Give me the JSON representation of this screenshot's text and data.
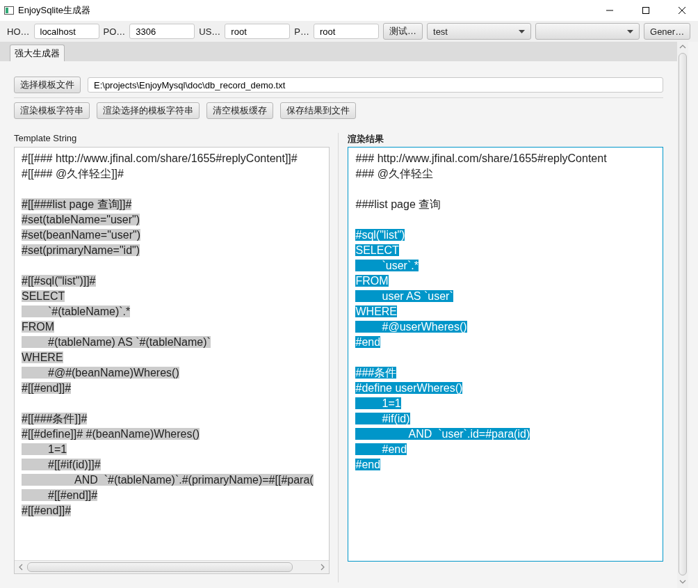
{
  "window": {
    "title": "EnjoySqlite生成器"
  },
  "connection": {
    "fields": [
      {
        "label": "HO…",
        "value": "localhost"
      },
      {
        "label": "PO…",
        "value": "3306"
      },
      {
        "label": "US…",
        "value": "root"
      },
      {
        "label": "P…",
        "value": "root"
      }
    ],
    "test_button": "测试…",
    "database_select": {
      "value": "test"
    },
    "generate_button": "Gener…"
  },
  "tabs": [
    {
      "label": "强大生成器",
      "selected": true
    }
  ],
  "file_row": {
    "button": "选择模板文件",
    "path": "E:\\projects\\EnjoyMysql\\doc\\db_record_demo.txt"
  },
  "actions": [
    "渲染模板字符串",
    "渲染选择的模板字符串",
    "清空模板缓存",
    "保存结果到文件"
  ],
  "template": {
    "title": "Template String",
    "lines": [
      {
        "kind": "code",
        "text": "#[[### http://www.jfinal.com/share/1655#replyContent]]#",
        "selected": false
      },
      {
        "kind": "code",
        "text": "#[[### @久伴轻尘]]#",
        "selected": false
      },
      {
        "kind": "blank"
      },
      {
        "kind": "code",
        "text": "#[[###list page 查询]]#",
        "selected": true
      },
      {
        "kind": "code",
        "text": "#set(tableName=\"user\")",
        "selected": true
      },
      {
        "kind": "code",
        "text": "#set(beanName=\"user\")",
        "selected": true
      },
      {
        "kind": "code",
        "text": "#set(primaryName=\"id\")",
        "selected": true
      },
      {
        "kind": "blank"
      },
      {
        "kind": "code",
        "text": "#[[#sql(\"list\")]]#",
        "selected": true
      },
      {
        "kind": "code",
        "text": "SELECT",
        "selected": true
      },
      {
        "kind": "code",
        "text": "\t`#(tableName)`.*",
        "selected": true
      },
      {
        "kind": "code",
        "text": "FROM",
        "selected": true
      },
      {
        "kind": "code",
        "text": "\t#(tableName) AS `#(tableName)`",
        "selected": true
      },
      {
        "kind": "code",
        "text": "WHERE",
        "selected": true
      },
      {
        "kind": "code",
        "text": "\t#@#(beanName)Wheres()",
        "selected": true
      },
      {
        "kind": "code",
        "text": "#[[#end]]#",
        "selected": true
      },
      {
        "kind": "blank"
      },
      {
        "kind": "code",
        "text": "#[[###条件]]#",
        "selected": true
      },
      {
        "kind": "code",
        "text": "#[[#define]]# #(beanName)Wheres()",
        "selected": true
      },
      {
        "kind": "code",
        "text": "\t1=1",
        "selected": true
      },
      {
        "kind": "code",
        "text": "\t#[[#if(id)]]#",
        "selected": true
      },
      {
        "kind": "code",
        "text": "\t\tAND  `#(tableName)`.#(primaryName)=#[[#para(",
        "selected": true
      },
      {
        "kind": "code",
        "text": "\t#[[#end]]#",
        "selected": true
      },
      {
        "kind": "code",
        "text": "#[[#end]]#",
        "selected": true
      }
    ]
  },
  "result": {
    "title": "渲染结果",
    "lines": [
      {
        "kind": "code",
        "text": "### http://www.jfinal.com/share/1655#replyContent",
        "selected": false
      },
      {
        "kind": "code",
        "text": "### @久伴轻尘",
        "selected": false
      },
      {
        "kind": "blank"
      },
      {
        "kind": "code",
        "text": "###list page 查询",
        "selected": false
      },
      {
        "kind": "blank"
      },
      {
        "kind": "code",
        "text": "#sql(\"list\")",
        "selected": true
      },
      {
        "kind": "code",
        "text": "SELECT",
        "selected": true
      },
      {
        "kind": "code",
        "text": "\t`user`.*",
        "selected": true
      },
      {
        "kind": "code",
        "text": "FROM",
        "selected": true
      },
      {
        "kind": "code",
        "text": "\tuser AS `user`",
        "selected": true
      },
      {
        "kind": "code",
        "text": "WHERE",
        "selected": true
      },
      {
        "kind": "code",
        "text": "\t#@userWheres()",
        "selected": true
      },
      {
        "kind": "code",
        "text": "#end",
        "selected": true
      },
      {
        "kind": "blank"
      },
      {
        "kind": "code",
        "text": "###条件",
        "selected": true
      },
      {
        "kind": "code",
        "text": "#define userWheres()",
        "selected": true
      },
      {
        "kind": "code",
        "text": "\t1=1",
        "selected": true
      },
      {
        "kind": "code",
        "text": "\t#if(id)",
        "selected": true
      },
      {
        "kind": "code",
        "text": "\t\tAND  `user`.id=#para(id)",
        "selected": true
      },
      {
        "kind": "code",
        "text": "\t#end",
        "selected": true
      },
      {
        "kind": "code",
        "text": "#end",
        "selected": true
      }
    ]
  }
}
